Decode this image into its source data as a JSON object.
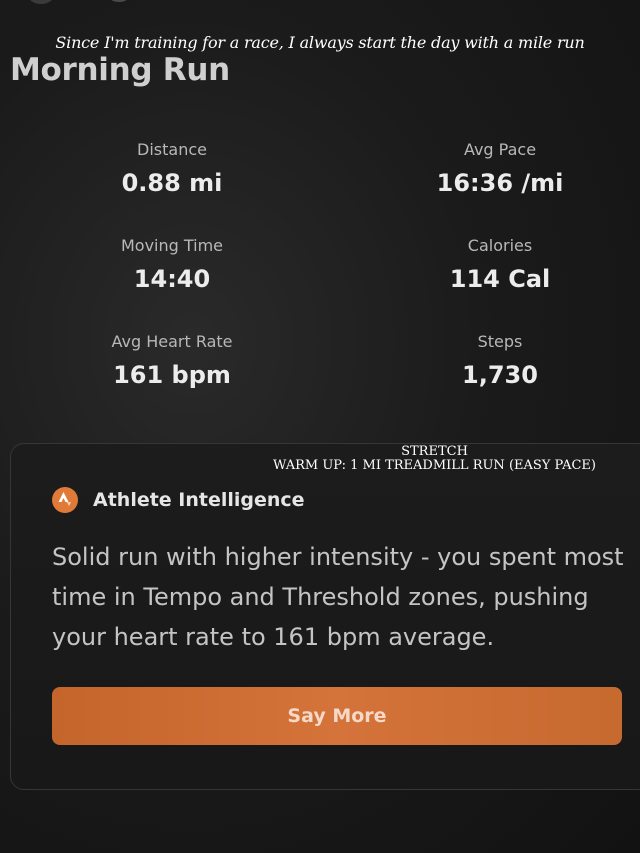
{
  "caption": "Since I'm training for a race, I always start the day with a mile run",
  "activity": {
    "title": "Morning Run"
  },
  "stats": [
    {
      "label": "Distance",
      "value": "0.88 mi"
    },
    {
      "label": "Avg Pace",
      "value": "16:36 /mi"
    },
    {
      "label": "Moving Time",
      "value": "14:40"
    },
    {
      "label": "Calories",
      "value": "114 Cal"
    },
    {
      "label": "Avg Heart Rate",
      "value": "161 bpm"
    },
    {
      "label": "Steps",
      "value": "1,730"
    }
  ],
  "overlay_text": {
    "line1": "STRETCH",
    "line2": "WARM UP: 1 MI TREADMILL RUN (EASY PACE)"
  },
  "athlete_intelligence": {
    "icon": "strava-logo-icon",
    "label": "Athlete Intelligence",
    "summary": "Solid run with higher intensity - you spent most time in Tempo and Threshold zones, pushing your heart rate to 161 bpm average.",
    "button_label": "Say More"
  },
  "colors": {
    "accent": "#d4733a",
    "background": "#1b1b1b"
  }
}
